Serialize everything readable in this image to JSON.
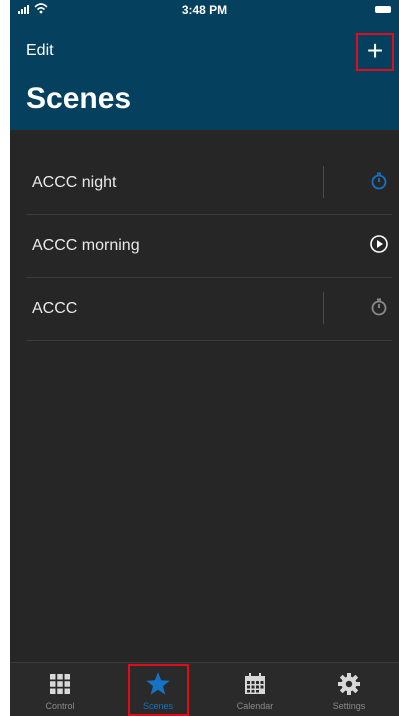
{
  "status_bar": {
    "time": "3:48 PM"
  },
  "nav": {
    "edit_label": "Edit",
    "add_label": "+",
    "title": "Scenes"
  },
  "scenes": [
    {
      "name": "ACCC night",
      "action_icon": "timer-icon",
      "accent": "#1473c4"
    },
    {
      "name": "ACCC morning",
      "action_icon": "play-circle-icon",
      "accent": "#ffffff"
    },
    {
      "name": "ACCC",
      "action_icon": "timer-icon",
      "accent": "#8a8a8a"
    }
  ],
  "tabs": [
    {
      "label": "Control",
      "icon": "grid-icon"
    },
    {
      "label": "Scenes",
      "icon": "star-icon",
      "selected": true
    },
    {
      "label": "Calendar",
      "icon": "calendar-icon"
    },
    {
      "label": "Settings",
      "icon": "gear-icon"
    }
  ],
  "colors": {
    "header": "#05405f",
    "background": "#262626",
    "accent": "#1473c4",
    "highlight_box": "#e10c1b"
  }
}
